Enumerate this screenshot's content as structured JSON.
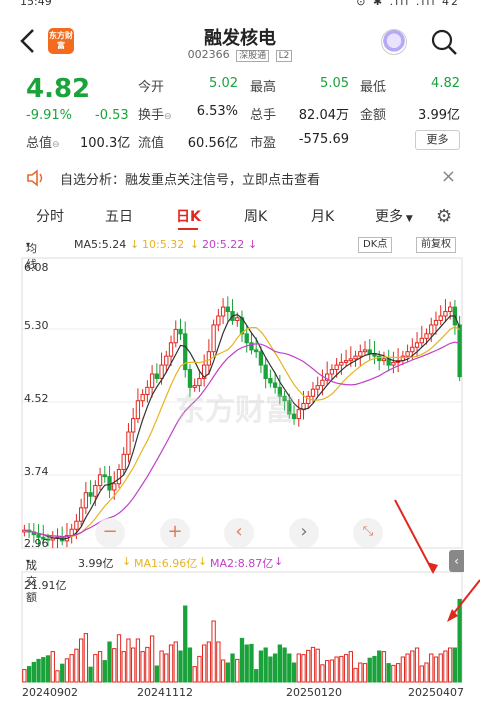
{
  "status_bar": {
    "time": "15:49",
    "right": "⊙ ✱ .ıll .ıll 42"
  },
  "header": {
    "logo": "东方财富",
    "title": "融发核电",
    "code": "002366",
    "market_tag": "深股通",
    "level_tag": "L2"
  },
  "quote": {
    "price": "4.82",
    "pct": "-9.91%",
    "change": "-0.53",
    "market_cap_label": "总值",
    "market_cap": "100.3亿",
    "float_label": "流值",
    "float_cap": "60.56亿",
    "pe_label": "市盈",
    "pe_value": "-575.69",
    "open_label": "今开",
    "open": "5.02",
    "high_label": "最高",
    "high": "5.05",
    "low_label": "最低",
    "low": "4.82",
    "turnover_label": "换手",
    "turnover": "6.53%",
    "volume_label": "总手",
    "volume": "82.04万",
    "amount_label": "金额",
    "amount": "3.99亿",
    "more": "更多"
  },
  "banner": {
    "text": "自选分析：融发重点关注信号，立即点击查看"
  },
  "tabs": [
    "分时",
    "五日",
    "日K",
    "周K",
    "月K",
    "更多"
  ],
  "active_tab": "日K",
  "ma_row": {
    "type": "均线",
    "ma5": "MA5:5.24",
    "ma10": "10:5.32",
    "ma20": "20:5.22",
    "dk": "DK点",
    "adjust": "前复权"
  },
  "vol_row": {
    "label": "成交额",
    "value": "3.99亿",
    "ma1": "MA1:6.96亿",
    "ma2": "MA2:8.87亿"
  },
  "colors": {
    "up": "#e0281f",
    "down": "#1aa33a",
    "ma5": "#333333",
    "ma10": "#e6b422",
    "ma20": "#c23fc8"
  },
  "chart_data": {
    "type": "candlestick",
    "price_axis_ticks": [
      "6.08",
      "5.30",
      "4.52",
      "3.74",
      "2.96"
    ],
    "volume_axis_max": "21.91亿",
    "x_tick_labels": [
      "20240902",
      "20241112",
      "20250120",
      "20250407"
    ],
    "series": [
      {
        "name": "MA5",
        "last": 5.24
      },
      {
        "name": "10",
        "last": 5.32
      },
      {
        "name": "20",
        "last": 5.22
      }
    ],
    "close": [
      3.1,
      3.08,
      3.05,
      3.02,
      3.0,
      2.99,
      3.01,
      3.02,
      2.98,
      3.04,
      3.11,
      3.2,
      3.35,
      3.52,
      3.48,
      3.6,
      3.72,
      3.7,
      3.55,
      3.62,
      3.78,
      3.95,
      4.2,
      4.35,
      4.55,
      4.62,
      4.7,
      4.85,
      4.8,
      4.95,
      5.05,
      5.2,
      5.35,
      5.3,
      4.9,
      4.7,
      4.72,
      4.8,
      4.95,
      5.1,
      5.4,
      5.5,
      5.6,
      5.55,
      5.45,
      5.48,
      5.3,
      5.2,
      5.12,
      5.1,
      4.95,
      4.8,
      4.75,
      4.7,
      4.6,
      4.55,
      4.4,
      4.35,
      4.45,
      4.52,
      4.6,
      4.68,
      4.72,
      4.78,
      4.85,
      4.9,
      4.95,
      4.98,
      5.0,
      5.02,
      5.05,
      5.1,
      5.12,
      5.08,
      5.05,
      5.0,
      5.02,
      4.95,
      4.98,
      5.0,
      5.05,
      5.1,
      5.15,
      5.2,
      5.25,
      5.3,
      5.4,
      5.45,
      5.5,
      5.55,
      5.6,
      5.4,
      4.82
    ]
  }
}
